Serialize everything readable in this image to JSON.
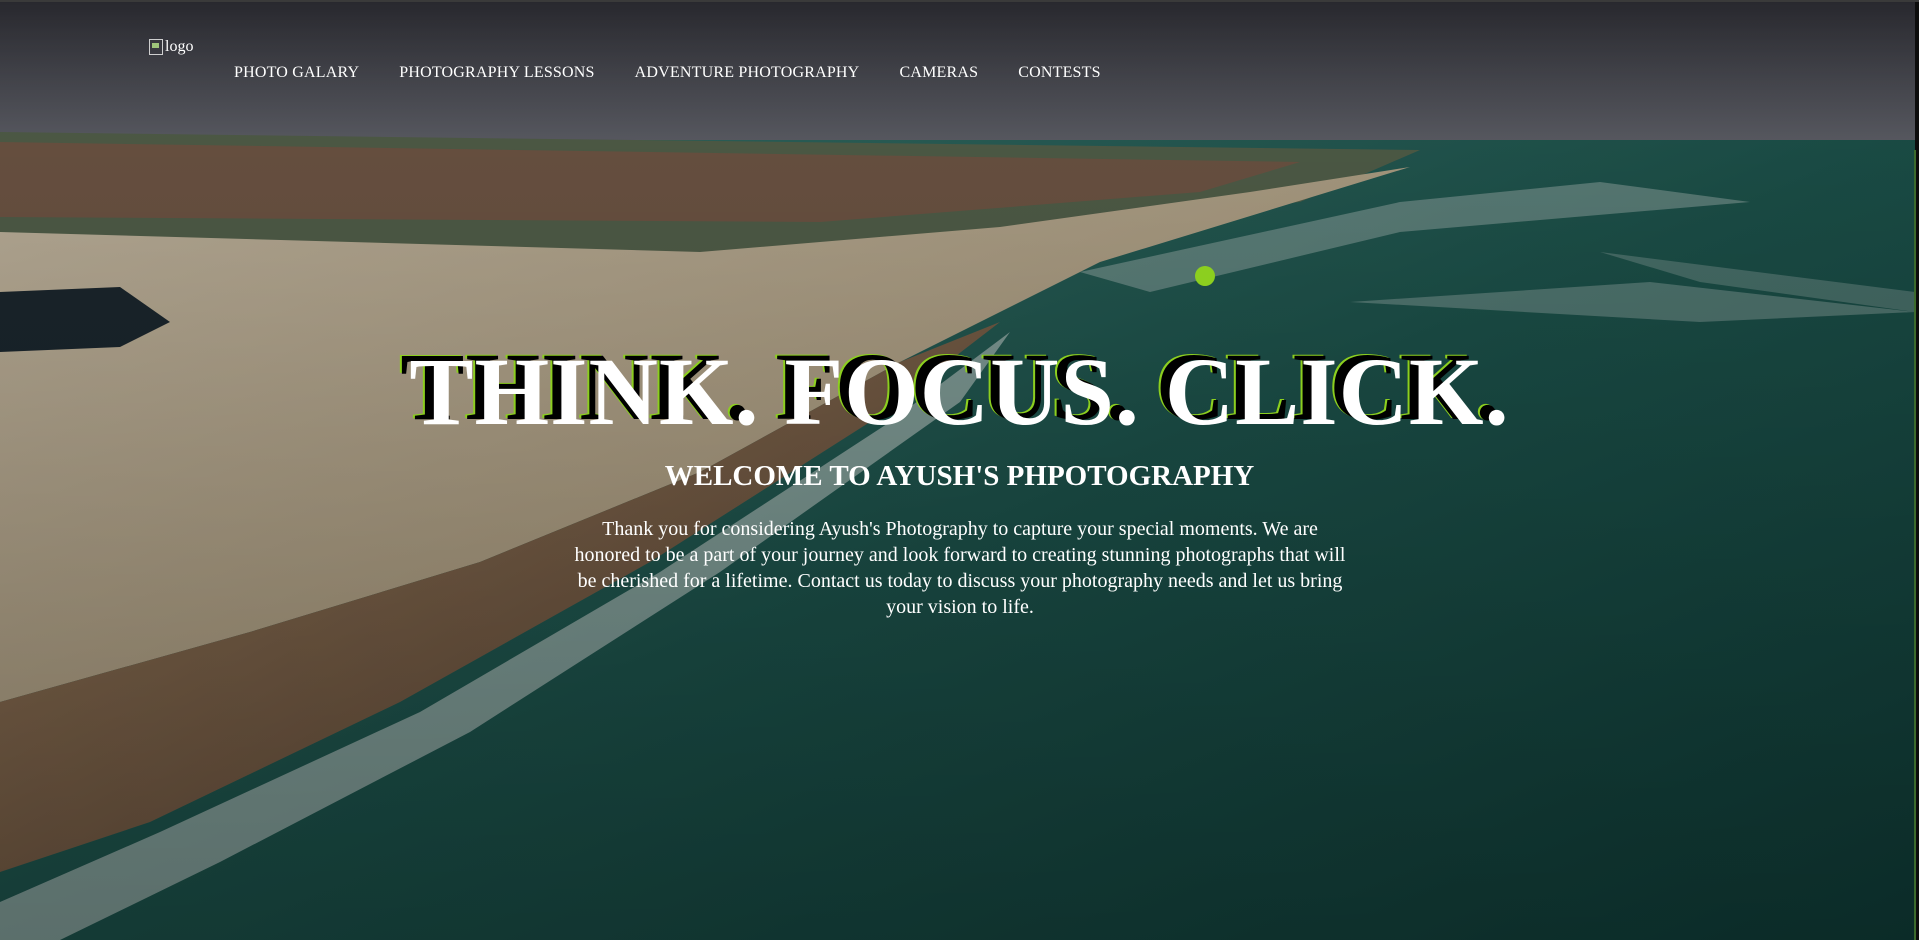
{
  "logo": {
    "alt": "logo"
  },
  "nav": {
    "items": [
      {
        "label": "PHOTO GALARY"
      },
      {
        "label": "PHOTOGRAPHY LESSONS"
      },
      {
        "label": "ADVENTURE PHOTOGRAPHY"
      },
      {
        "label": "CAMERAS"
      },
      {
        "label": "CONTESTS"
      }
    ]
  },
  "hero": {
    "headline": "THINK. FOCUS. CLICK.",
    "welcome": "WELCOME TO AYUSH'S PHPOTOGRAPHY",
    "blurb": "Thank you for considering Ayush's Photography to capture your special moments. We are honored to be a part of your journey and look forward to creating stunning photographs that will be cherished for a lifetime. Contact us today to discuss your photography needs and let us bring your vision to life."
  },
  "colors": {
    "accent": "#8ccf1f",
    "text": "#ffffff",
    "sea": "#1f5a52",
    "sand": "#cfc2a9"
  }
}
